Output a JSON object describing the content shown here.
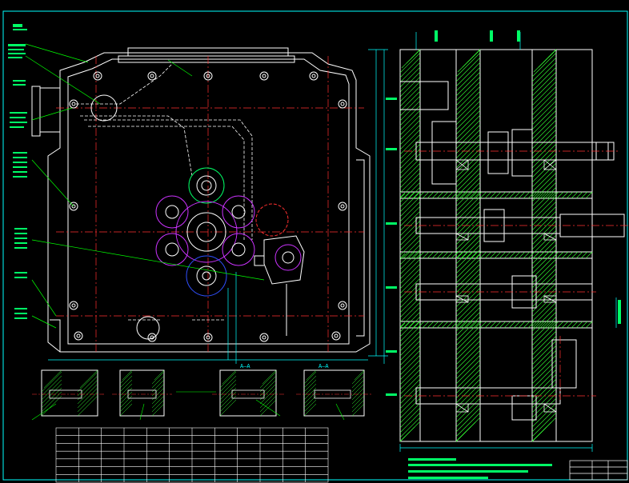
{
  "drawing": {
    "title": "",
    "colors": {
      "background": "#000000",
      "frame": "#00ffff",
      "outline": "#ffffff",
      "centerline": "#ff3030",
      "leader": "#00ff00",
      "callout": "#00ff66",
      "gear": "#cc33ff",
      "blue": "#3050ff",
      "hatch": "#33ff33",
      "dim": "#00ffff",
      "shaft": "#ffffff"
    },
    "icons": [
      "gearbox-housing",
      "gear-circle",
      "bolt-hole",
      "section-hatch"
    ]
  },
  "main_view": {
    "section_labels": [
      "A—A",
      "A—A"
    ]
  },
  "table": {
    "rows": 7,
    "cols": 12
  },
  "notes": {
    "title_block_text": ""
  }
}
